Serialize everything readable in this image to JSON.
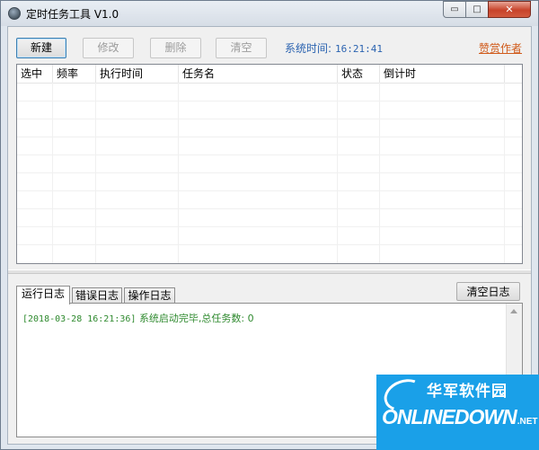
{
  "window": {
    "title": "定时任务工具 V1.0",
    "controls": {
      "minimize": "▭",
      "maximize": "□",
      "close": "✕"
    }
  },
  "toolbar": {
    "new_label": "新建",
    "edit_label": "修改",
    "delete_label": "删除",
    "clear_label": "清空",
    "systime_label": "系统时间:",
    "systime_value": "16:21:41",
    "donate_label": "赞赏作者"
  },
  "task_table": {
    "columns": [
      "选中",
      "频率",
      "执行时间",
      "任务名",
      "状态",
      "倒计时"
    ],
    "rows": []
  },
  "log": {
    "tabs": [
      "运行日志",
      "错误日志",
      "操作日志"
    ],
    "active_tab": 0,
    "clear_label": "清空日志",
    "lines": [
      {
        "timestamp": "[2018-03-28 16:21:36]",
        "message": "系统启动完毕,总任务数: 0"
      }
    ]
  },
  "watermark": {
    "cn": "华军软件园",
    "en": "ONLINEDOWN",
    "suffix": ".NET"
  }
}
